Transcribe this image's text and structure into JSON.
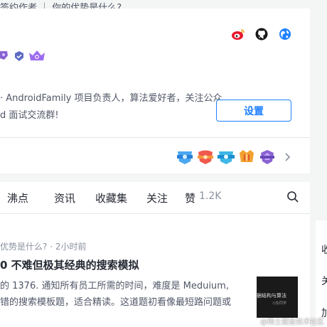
{
  "profile": {
    "author_line": "签约作者 ｜ 你的优势是什么?",
    "bio_line_1": "AndroidFamily 项目负责人，算法爱好者，关注公众",
    "bio_line_2": "d 面试交流群!",
    "settings_label": "设置",
    "social_icons": [
      "weibo-icon",
      "github-icon",
      "website-icon"
    ],
    "honor_badges": [
      "badge-1",
      "badge-2",
      "badge-3",
      "badge-4",
      "badge-5"
    ]
  },
  "tabs": {
    "items": [
      "沸点",
      "资讯",
      "收藏集",
      "关注",
      "赞"
    ],
    "likes_count": "1.2K"
  },
  "feed": {
    "meta_tag": "优势是什么?",
    "meta_time": "2小时前",
    "title": "0 不难但极其经典的搜索模拟",
    "line_1": "的 1376. 通知所有员工所需的时间，难度是 Meduium,",
    "line_2": "错的搜索模板题，适合精读。这道题初看像最短路问题或",
    "thumb_title": "据结构与算法",
    "thumb_sub": "小彭同学"
  },
  "side": {
    "labels": [
      "收",
      "关",
      "加"
    ]
  },
  "watermark": "@稀土掘金技术社区",
  "colors": {
    "accent": "#1e80ff",
    "text": "#252933",
    "muted": "#8a919f",
    "background": "#f4f5f5"
  }
}
